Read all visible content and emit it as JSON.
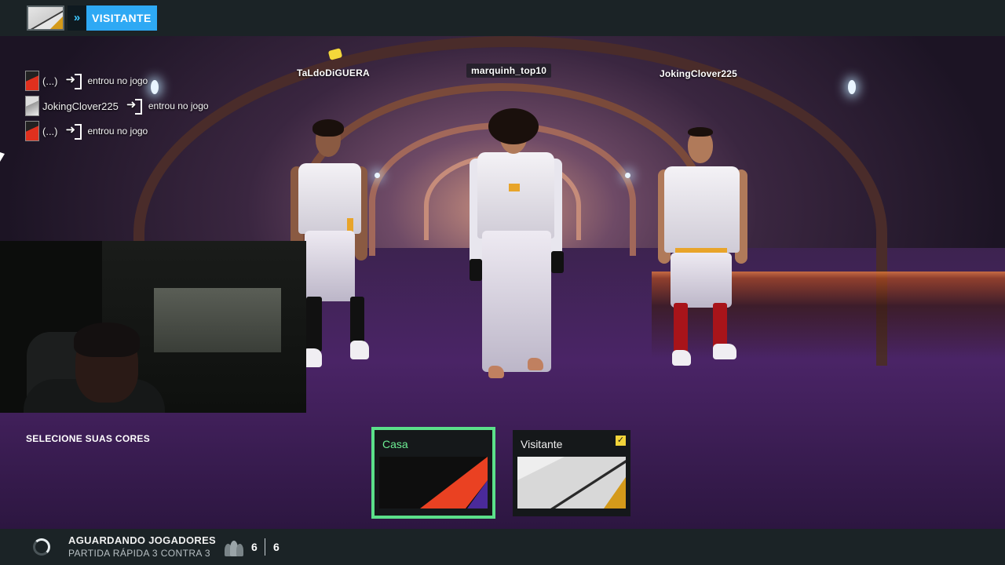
{
  "topbar": {
    "team_label": "VISITANTE",
    "team_arrow": "»"
  },
  "feed": [
    {
      "name": "(...)",
      "text": "entrou no jogo",
      "badge": "red"
    },
    {
      "name": "JokingClover225",
      "text": "entrou no jogo",
      "badge": "white"
    },
    {
      "name": "(...)",
      "text": "entrou no jogo",
      "badge": "red"
    }
  ],
  "players": [
    {
      "name": "TaLdoDiGUERA"
    },
    {
      "name": "marquinh_top10"
    },
    {
      "name": "JokingClover225"
    }
  ],
  "color_select": {
    "title": "SELECIONE SUAS CORES",
    "kits": [
      {
        "label": "Casa",
        "selected": true,
        "colors": [
          "#0e0e0e",
          "#ea4122",
          "#4a2a9a"
        ]
      },
      {
        "label": "Visitante",
        "checked": true,
        "check_glyph": "✓",
        "colors": [
          "#d8d8d8",
          "#2a2a2a",
          "#d49a1a"
        ]
      }
    ]
  },
  "status": {
    "title": "AGUARDANDO JOGADORES",
    "subtitle": "PARTIDA RÁPIDA 3 CONTRA 3",
    "players_current": "6",
    "players_max": "6"
  },
  "colors": {
    "topbar_bg": "#1b2326",
    "team_accent": "#2ea9f4",
    "selected_border": "#5be08a",
    "check": "#f2d43a"
  },
  "icons": {
    "team_arrow": "double-chevron-icon",
    "join": "enter-door-icon",
    "spinner": "loading-spinner-icon",
    "players": "people-icon",
    "check": "checkbox-checked-icon"
  }
}
